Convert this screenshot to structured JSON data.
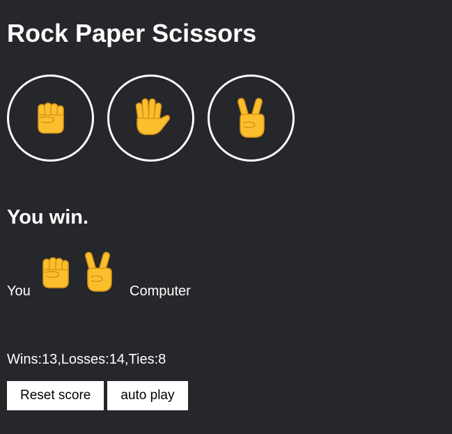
{
  "title": "Rock Paper Scissors",
  "colors": {
    "background": "#25272a",
    "text": "#ffffff",
    "hand_fill": "#fbbf2d",
    "hand_line": "#d9951a",
    "button_bg": "#ffffff",
    "button_text": "#000000"
  },
  "moves": [
    {
      "id": "rock",
      "icon": "fist-hand-icon"
    },
    {
      "id": "paper",
      "icon": "open-hand-icon"
    },
    {
      "id": "scissors",
      "icon": "victory-hand-icon"
    }
  ],
  "result": "You win.",
  "last_round": {
    "you_label": "You",
    "player_move": "rock",
    "computer_move": "scissors",
    "computer_label": "Computer"
  },
  "score": {
    "text": "Wins:13,Losses:14,Ties:8",
    "wins": 13,
    "losses": 14,
    "ties": 8
  },
  "actions": {
    "reset_label": "Reset score",
    "autoplay_label": "auto play"
  }
}
